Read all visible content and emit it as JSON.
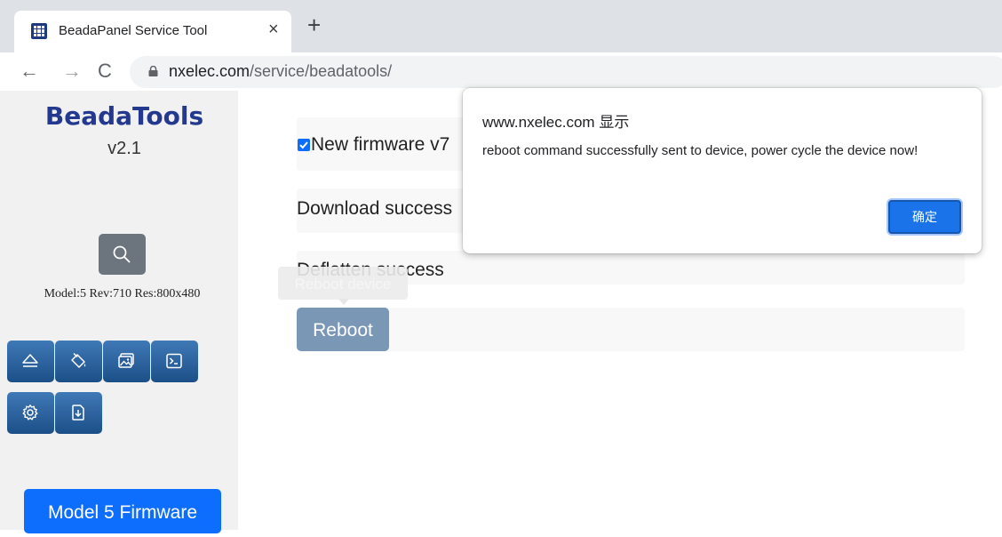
{
  "browser": {
    "tab_title": "BeadaPanel Service Tool",
    "tab_close": "×",
    "new_tab": "+",
    "back": "←",
    "forward": "→",
    "reload": "C",
    "url_host": "nxelec.com",
    "url_path": "/service/beadatools/"
  },
  "sidebar": {
    "title": "BeadaTools",
    "version": "v2.1",
    "model_info": "Model:5 Rev:710 Res:800x480",
    "tool_icons": [
      "eject-icon",
      "paint-bucket-icon",
      "images-icon",
      "terminal-icon",
      "gear-icon",
      "download-icon"
    ],
    "firmware_button": "Model 5 Firmware"
  },
  "main": {
    "firmware_line": "New firmware v7",
    "firmware_checked": true,
    "download_status": "Download success",
    "deflatten_status": "Deflatten success",
    "reboot_button": "Reboot",
    "reboot_tooltip": "Reboot device"
  },
  "dialog": {
    "title": "www.nxelec.com 显示",
    "message": "reboot command successfully sent to device, power cycle the device now!",
    "ok_button": "确定"
  },
  "colors": {
    "brand": "#23398f",
    "primary": "#0d6efd",
    "tool_button": "#2a5f9e",
    "reboot_button": "#7a97b6",
    "search_button": "#6c757d"
  }
}
